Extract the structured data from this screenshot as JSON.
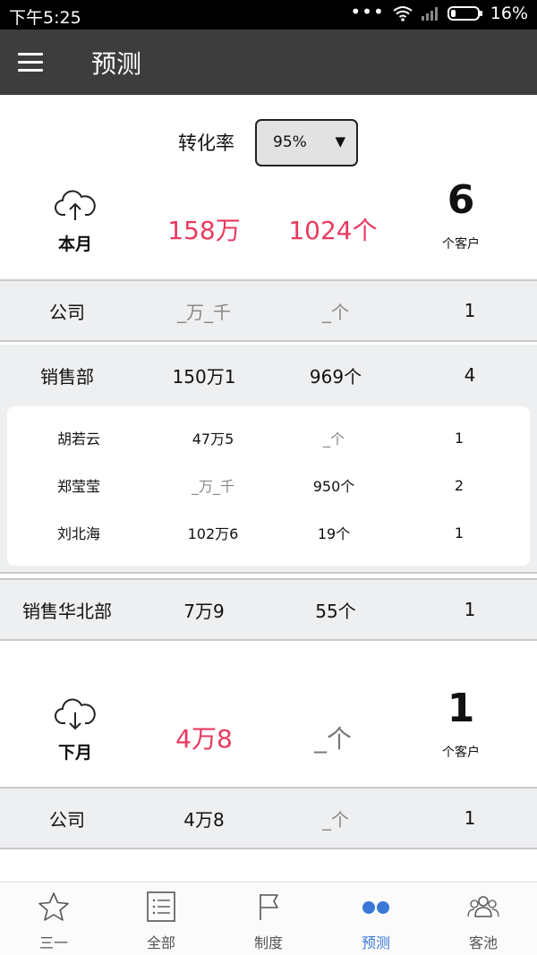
{
  "status_bar": {
    "time": "下午5:25",
    "battery": "16%"
  },
  "app_bar": {
    "title": "预测"
  },
  "conversion": {
    "label": "转化率",
    "selected": "95%"
  },
  "this_month": {
    "label": "本月",
    "amount": "158万",
    "count": "1024个",
    "customers": "6",
    "customers_unit": "个客户"
  },
  "this_month_rows": {
    "company": {
      "name": "公司",
      "amount": "_万_千",
      "count": "_个",
      "customers": "1"
    },
    "sales_dept": {
      "name": "销售部",
      "amount": "150万1",
      "count": "969个",
      "customers": "4",
      "members": [
        {
          "name": "胡若云",
          "amount": "47万5",
          "count": "_个",
          "customers": "1"
        },
        {
          "name": "郑莹莹",
          "amount": "_万_千",
          "count": "950个",
          "customers": "2"
        },
        {
          "name": "刘北海",
          "amount": "102万6",
          "count": "19个",
          "customers": "1"
        }
      ]
    },
    "north_dept": {
      "name": "销售华北部",
      "amount": "7万9",
      "count": "55个",
      "customers": "1"
    }
  },
  "next_month": {
    "label": "下月",
    "amount": "4万8",
    "count": "_个",
    "customers": "1",
    "customers_unit": "个客户"
  },
  "next_month_rows": {
    "company": {
      "name": "公司",
      "amount": "4万8",
      "count": "_个",
      "customers": "1"
    }
  },
  "tabs": [
    {
      "label": "三一",
      "icon": "star-icon"
    },
    {
      "label": "全部",
      "icon": "list-icon"
    },
    {
      "label": "制度",
      "icon": "flag-icon"
    },
    {
      "label": "预测",
      "icon": "forecast-icon",
      "active": true
    },
    {
      "label": "客池",
      "icon": "customers-icon"
    }
  ],
  "colors": {
    "accent_pink": "#e83a5f",
    "tab_active": "#3a78d8",
    "app_bar": "#3d3d3d"
  }
}
